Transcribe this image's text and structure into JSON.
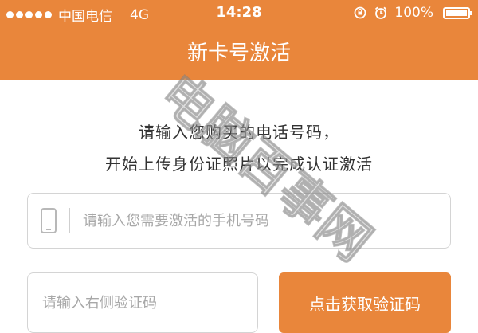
{
  "status_bar": {
    "carrier": "中国电信",
    "network": "4G",
    "time": "14:28",
    "battery": "100%",
    "signal_bars": 5
  },
  "nav": {
    "title": "新卡号激活"
  },
  "intro": {
    "line1": "请输入您购买的电话号码，",
    "line2": "开始上传身份证照片以完成认证激活"
  },
  "form": {
    "phone_placeholder": "请输入您需要激活的手机号码",
    "code_placeholder": "请输入右侧验证码",
    "get_code_label": "点击获取验证码"
  },
  "watermark": {
    "text": "电脑百事网"
  },
  "colors": {
    "accent": "#e9863b",
    "text": "#333333",
    "placeholder": "#a8a8a8",
    "border": "#d4d4d4"
  }
}
